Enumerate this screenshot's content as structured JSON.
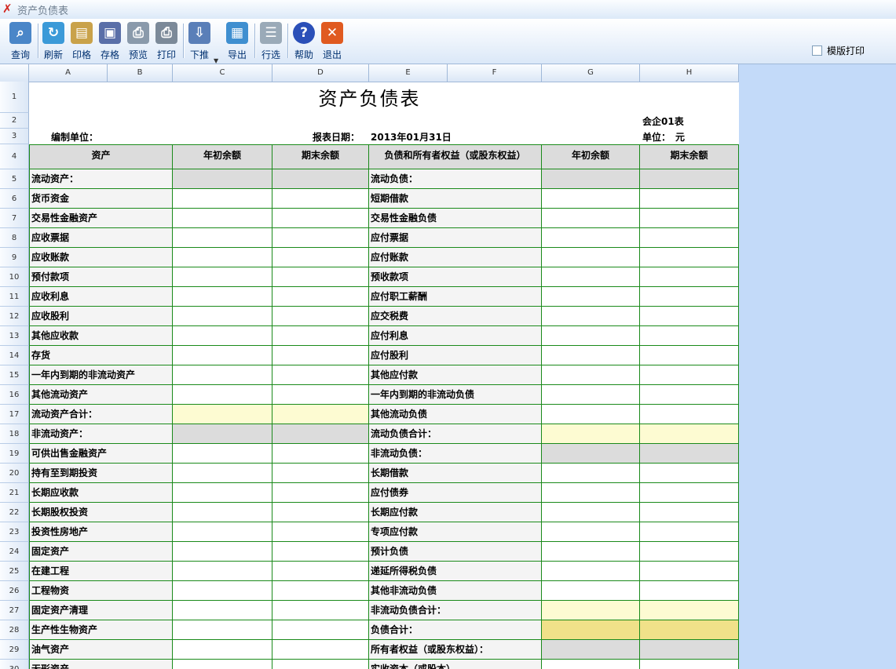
{
  "window": {
    "title": "资产负债表",
    "app_icon": "accounting-icon"
  },
  "toolbar": {
    "buttons": [
      {
        "label": "查询",
        "icon": "magnifier-icon"
      },
      {
        "label": "刷新",
        "icon": "refresh-icon"
      },
      {
        "label": "印格",
        "icon": "print-format-icon"
      },
      {
        "label": "存格",
        "icon": "save-icon"
      },
      {
        "label": "预览",
        "icon": "preview-icon"
      },
      {
        "label": "打印",
        "icon": "printer-icon"
      },
      {
        "label": "下推",
        "icon": "push-down-icon"
      },
      {
        "label": "导出",
        "icon": "export-icon"
      },
      {
        "label": "行选",
        "icon": "row-select-icon"
      },
      {
        "label": "帮助",
        "icon": "help-icon"
      },
      {
        "label": "退出",
        "icon": "exit-icon"
      }
    ],
    "template_print_label": "模版打印",
    "template_print_checked": false
  },
  "grid": {
    "columns": [
      "A",
      "B",
      "C",
      "D",
      "E",
      "F",
      "G",
      "H"
    ],
    "row_numbers": [
      "1",
      "2",
      "3",
      "4",
      "5",
      "6",
      "7",
      "8",
      "9",
      "10",
      "11",
      "12",
      "13",
      "14",
      "15",
      "16",
      "17",
      "18",
      "19",
      "20",
      "21",
      "22",
      "23",
      "24",
      "25",
      "26",
      "27",
      "28",
      "29",
      "30"
    ]
  },
  "report": {
    "title": "资产负债表",
    "form_code": "会企01表",
    "company_label": "编制单位：",
    "date_label": "报表日期：",
    "date_value": "2013年01月31日",
    "unit_label": "单位：",
    "unit_value": "元",
    "headers": [
      "资产",
      "年初余额",
      "期末余额",
      "负债和所有者权益（或股东权益）",
      "年初余额",
      "期末余额"
    ],
    "left_items": [
      "流动资产：",
      "货币资金",
      "交易性金融资产",
      "应收票据",
      "应收账款",
      "预付款项",
      "应收利息",
      "应收股利",
      "其他应收款",
      "存货",
      "一年内到期的非流动资产",
      "其他流动资产",
      "流动资产合计：",
      "非流动资产：",
      "可供出售金融资产",
      "持有至到期投资",
      "长期应收款",
      "长期股权投资",
      "投资性房地产",
      "固定资产",
      "在建工程",
      "工程物资",
      "固定资产清理",
      "生产性生物资产",
      "油气资产",
      "无形资产"
    ],
    "right_items": [
      "流动负债：",
      "短期借款",
      "交易性金融负债",
      "应付票据",
      "应付账款",
      "预收款项",
      "应付职工薪酬",
      "应交税费",
      "应付利息",
      "应付股利",
      "其他应付款",
      "一年内到期的非流动负债",
      "其他流动负债",
      "流动负债合计：",
      "非流动负债：",
      "长期借款",
      "应付债券",
      "长期应付款",
      "专项应付款",
      "预计负债",
      "递延所得税负债",
      "其他非流动负债",
      "非流动负债合计：",
      "负债合计：",
      "所有者权益（或股东权益）：",
      "实收资本（或股本）"
    ],
    "left_value_styles": [
      "gray",
      "",
      "",
      "",
      "",
      "",
      "",
      "",
      "",
      "",
      "",
      "",
      "yellow",
      "gray",
      "",
      "",
      "",
      "",
      "",
      "",
      "",
      "",
      "",
      "",
      "",
      ""
    ],
    "right_value_styles": [
      "gray",
      "",
      "",
      "",
      "",
      "",
      "",
      "",
      "",
      "",
      "",
      "",
      "",
      "yellow",
      "gray",
      "",
      "",
      "",
      "",
      "",
      "",
      "",
      "yellow",
      "gold",
      "gray",
      ""
    ]
  },
  "colors": {
    "border": "#1a8a1a",
    "subtotal": "#fdfbd2",
    "total": "#f0e189",
    "section": "#dcdcdc"
  }
}
